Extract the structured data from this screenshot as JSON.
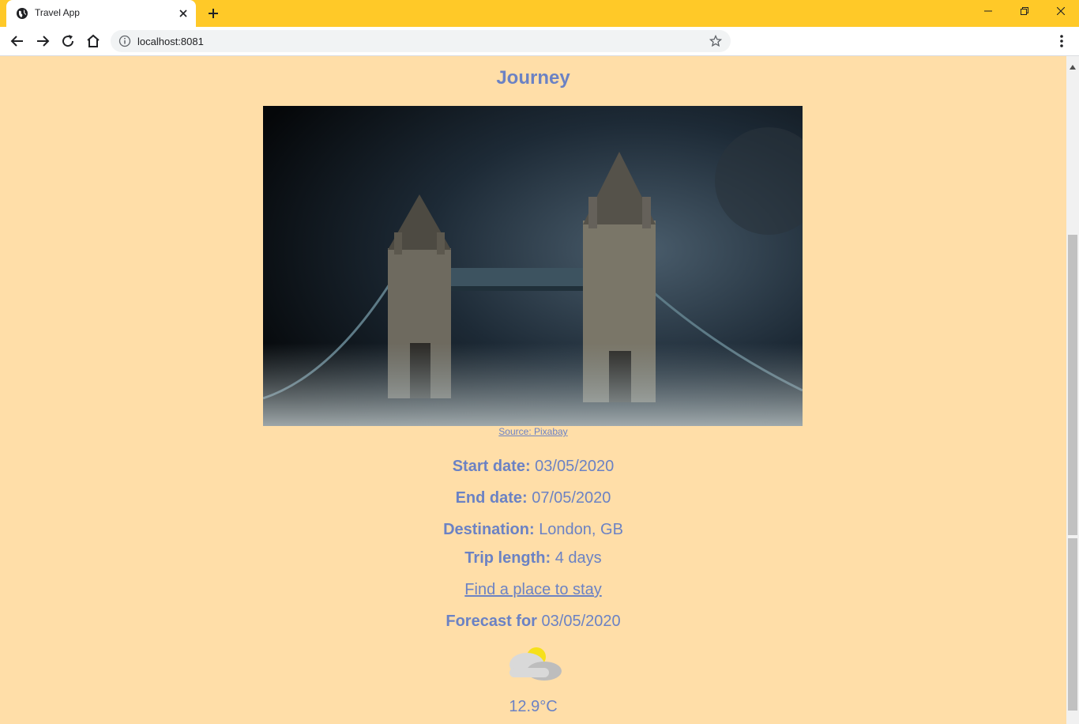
{
  "browser": {
    "tab_title": "Travel App",
    "url": "localhost:8081",
    "icons": {
      "favicon": "globe-icon",
      "close": "close-icon",
      "new_tab": "plus-icon",
      "back": "back-arrow-icon",
      "forward": "forward-arrow-icon",
      "reload": "reload-icon",
      "home": "home-icon",
      "info": "info-icon",
      "bookmark": "star-icon",
      "menu": "kebab-menu-icon"
    },
    "accent_color": "#ffc928"
  },
  "page": {
    "title": "Journey",
    "image_source_label": "Source: Pixabay",
    "start_date_label": "Start date:",
    "start_date": "03/05/2020",
    "end_date_label": "End date:",
    "end_date": "07/05/2020",
    "destination_label": "Destination:",
    "destination": "London, GB",
    "trip_length_label": "Trip length:",
    "trip_length": "4 days",
    "stay_link": "Find a place to stay",
    "forecast_label": "Forecast for",
    "forecast_date": "03/05/2020",
    "weather_icon": "partly-cloudy-icon",
    "temperature": "12.9°C",
    "background_color": "#ffdea8",
    "text_color": "#6b82c4"
  }
}
